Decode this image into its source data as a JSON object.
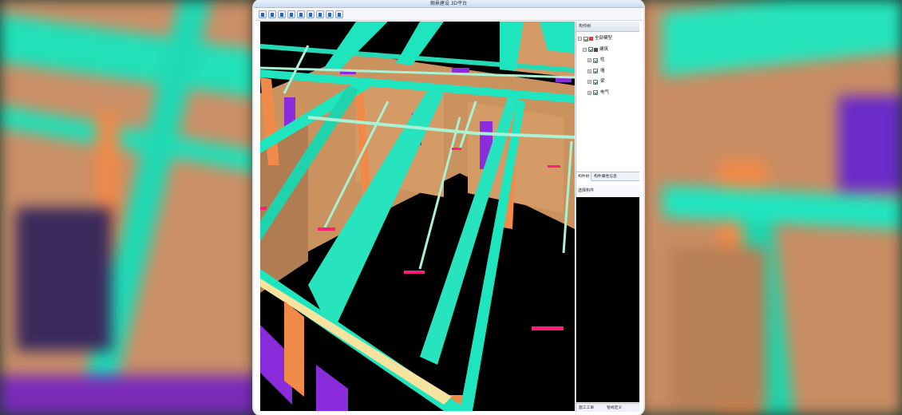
{
  "window": {
    "title": "翱景建设 3D平台"
  },
  "toolbar": {
    "buttons": [
      "open-icon",
      "save-icon",
      "view-icon",
      "layer-icon",
      "cut-icon",
      "measure-icon",
      "roam-icon",
      "zoom-icon",
      "settings-icon"
    ]
  },
  "panel": {
    "heading": "构件树",
    "tree": [
      {
        "label": "全部模型",
        "level": 0
      },
      {
        "label": "建筑",
        "level": 1
      },
      {
        "label": "柱",
        "level": 2
      },
      {
        "label": "墙",
        "level": 2
      },
      {
        "label": "梁",
        "level": 2
      },
      {
        "label": "电气",
        "level": 2
      }
    ],
    "tabs": [
      "构件树",
      "构件属性信息"
    ],
    "sub_heading": "选择构件",
    "bottom_tabs": [
      "施工工单",
      "管线定义"
    ]
  },
  "colors": {
    "beam": "#1fe5bf",
    "pipe": "#a9f2d3",
    "column": "#f08a48",
    "wall": "#c9925f",
    "door": "#8a2bdc",
    "valve": "#ff1f7a",
    "floor": "#000000"
  }
}
